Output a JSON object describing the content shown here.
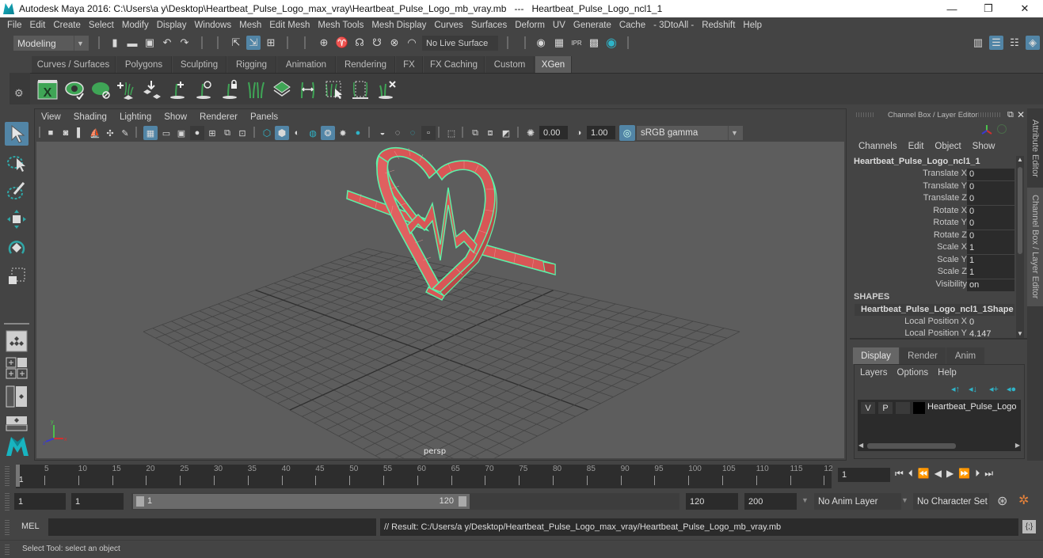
{
  "window": {
    "title": "Autodesk Maya 2016: C:\\Users\\a y\\Desktop\\Heartbeat_Pulse_Logo_max_vray\\Heartbeat_Pulse_Logo_mb_vray.mb   ---   Heartbeat_Pulse_Logo_ncl1_1",
    "minimize": "—",
    "maximize": "❐",
    "close": "✕"
  },
  "menubar": [
    "File",
    "Edit",
    "Create",
    "Select",
    "Modify",
    "Display",
    "Windows",
    "Mesh",
    "Edit Mesh",
    "Mesh Tools",
    "Mesh Display",
    "Curves",
    "Surfaces",
    "Deform",
    "UV",
    "Generate",
    "Cache",
    "- 3DtoAll -",
    "Redshift",
    "Help"
  ],
  "statusline": {
    "menuset": "Modeling",
    "live_surface": "No Live Surface"
  },
  "shelf": {
    "tabs": [
      "Curves / Surfaces",
      "Polygons",
      "Sculpting",
      "Rigging",
      "Animation",
      "Rendering",
      "FX",
      "FX Caching",
      "Custom",
      "XGen"
    ],
    "active_tab": "XGen",
    "icons": [
      "xgen-editor-icon",
      "toggle-preview-icon",
      "clear-preview-icon",
      "create-description-icon",
      "place-guides-icon",
      "add-guide-icon",
      "sculpt-guide-icon",
      "lock-guide-icon",
      "guides-to-curves-icon",
      "create-patch-icon",
      "cut-guides-icon",
      "select-guides-icon",
      "scale-guides-icon",
      "delete-guides-icon"
    ]
  },
  "panel": {
    "menu": [
      "View",
      "Shading",
      "Lighting",
      "Show",
      "Renderer",
      "Panels"
    ],
    "exposure": "0.00",
    "gamma": "1.00",
    "color_space": "sRGB gamma",
    "camera_label": "persp",
    "axis": {
      "x": "x",
      "y": "y",
      "z": "z"
    }
  },
  "channel_box": {
    "header": "Channel Box / Layer Editor",
    "menu": [
      "Channels",
      "Edit",
      "Object",
      "Show"
    ],
    "object_name": "Heartbeat_Pulse_Logo_ncl1_1",
    "channels": [
      {
        "label": "Translate X",
        "value": "0"
      },
      {
        "label": "Translate Y",
        "value": "0"
      },
      {
        "label": "Translate Z",
        "value": "0"
      },
      {
        "label": "Rotate X",
        "value": "0"
      },
      {
        "label": "Rotate Y",
        "value": "0"
      },
      {
        "label": "Rotate Z",
        "value": "0"
      },
      {
        "label": "Scale X",
        "value": "1"
      },
      {
        "label": "Scale Y",
        "value": "1"
      },
      {
        "label": "Scale Z",
        "value": "1"
      },
      {
        "label": "Visibility",
        "value": "on"
      }
    ],
    "shapes_header": "SHAPES",
    "shape_name": "Heartbeat_Pulse_Logo_ncl1_1Shape",
    "shape_channels": [
      {
        "label": "Local Position X",
        "value": "0"
      },
      {
        "label": "Local Position Y",
        "value": "4.147"
      }
    ]
  },
  "layer_editor": {
    "tabs": [
      "Display",
      "Render",
      "Anim"
    ],
    "active_tab": "Display",
    "menu": [
      "Layers",
      "Options",
      "Help"
    ],
    "layers": [
      {
        "v": "V",
        "p": "P",
        "name": "Heartbeat_Pulse_Logo",
        "color": "#000000"
      }
    ]
  },
  "side_tabs": [
    "Attribute Editor",
    "Channel Box / Layer Editor"
  ],
  "timeline": {
    "ticks": [
      "5",
      "10",
      "15",
      "20",
      "25",
      "30",
      "35",
      "40",
      "45",
      "50",
      "55",
      "60",
      "65",
      "70",
      "75",
      "80",
      "85",
      "90",
      "95",
      "100",
      "105",
      "110",
      "115",
      "12"
    ],
    "current_frame_marker": "1",
    "current_frame": "1"
  },
  "range": {
    "start": "1",
    "playback_start": "1",
    "slider_start": "1",
    "slider_end": "120",
    "playback_end": "120",
    "end": "200",
    "anim_layer": "No Anim Layer",
    "character_set": "No Character Set"
  },
  "cmdline": {
    "language": "MEL",
    "input": "",
    "result": "// Result: C:/Users/a y/Desktop/Heartbeat_Pulse_Logo_max_vray/Heartbeat_Pulse_Logo_mb_vray.mb"
  },
  "helpline": "Select Tool: select an object",
  "colors": {
    "accent": "#5285a6",
    "wire": "#5cf2a8",
    "mesh": "#e05a5a",
    "viewport_bg": "#5d5d5d",
    "key_orange": "#e8833a"
  }
}
